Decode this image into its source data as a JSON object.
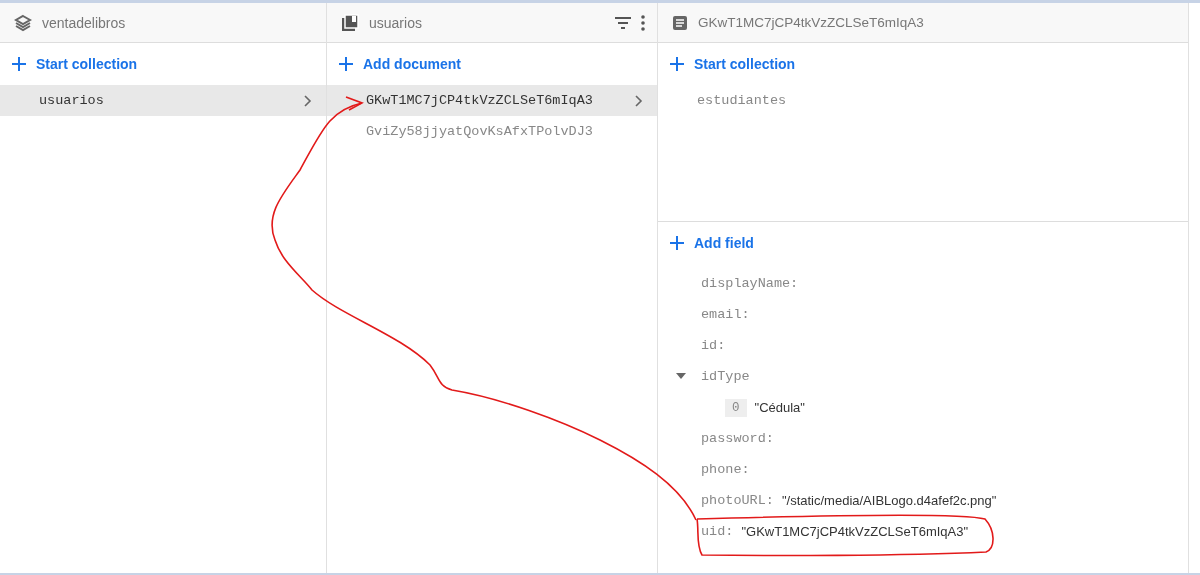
{
  "panels": [
    {
      "title": "ventadelibros",
      "action": "Start collection",
      "items": [
        {
          "label": "usuarios",
          "selected": true
        }
      ]
    },
    {
      "title": "usuarios",
      "action": "Add document",
      "items": [
        {
          "label": "GKwT1MC7jCP4tkVzZCLSeT6mIqA3",
          "selected": true
        },
        {
          "label": "GviZy58jjyatQovKsAfxTPolvDJ3",
          "selected": false
        }
      ]
    },
    {
      "title": "GKwT1MC7jCP4tkVzZCLSeT6mIqA3",
      "action": "Start collection",
      "items": [
        {
          "label": "estudiantes",
          "selected": false
        }
      ],
      "field_action": "Add field",
      "fields": [
        {
          "name": "displayName:"
        },
        {
          "name": "email:"
        },
        {
          "name": "id:"
        },
        {
          "name": "idType",
          "expanded": true,
          "children": [
            {
              "index": "0",
              "value": "\"Cédula\""
            }
          ]
        },
        {
          "name": "password:"
        },
        {
          "name": "phone:"
        },
        {
          "name": "photoURL:",
          "value": "\"/static/media/AIBLogo.d4afef2c.png\""
        },
        {
          "name": "uid:",
          "value": "\"GKwT1MC7jCP4tkVzZCLSeT6mIqA3\""
        }
      ]
    }
  ]
}
